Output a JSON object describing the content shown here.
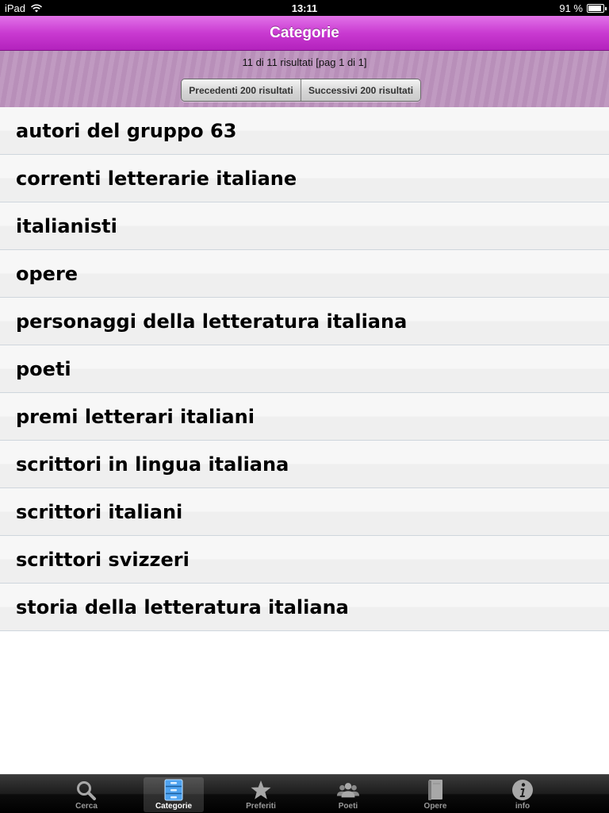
{
  "status_bar": {
    "device": "iPad",
    "time": "13:11",
    "battery": "91 %",
    "battery_level": 0.91
  },
  "nav": {
    "title": "Categorie"
  },
  "pager": {
    "info": "11 di 11 risultati [pag 1 di 1]",
    "prev_label": "Precedenti 200 risultati",
    "next_label": "Successivi 200 risultati"
  },
  "categories": [
    "autori del gruppo 63",
    "correnti letterarie italiane",
    "italianisti",
    "opere",
    "personaggi della letteratura italiana",
    "poeti",
    "premi letterari italiani",
    "scrittori in lingua italiana",
    "scrittori italiani",
    "scrittori svizzeri",
    "storia della letteratura italiana"
  ],
  "tabs": [
    {
      "label": "Cerca",
      "icon": "search-icon",
      "active": false
    },
    {
      "label": "Categorie",
      "icon": "drawer-icon",
      "active": true
    },
    {
      "label": "Preferiti",
      "icon": "star-icon",
      "active": false
    },
    {
      "label": "Poeti",
      "icon": "people-icon",
      "active": false
    },
    {
      "label": "Opere",
      "icon": "book-icon",
      "active": false
    },
    {
      "label": "info",
      "icon": "info-icon",
      "active": false
    }
  ],
  "colors": {
    "nav_accent": "#c93ad1",
    "tab_active_icon": "#4fa3f0"
  }
}
